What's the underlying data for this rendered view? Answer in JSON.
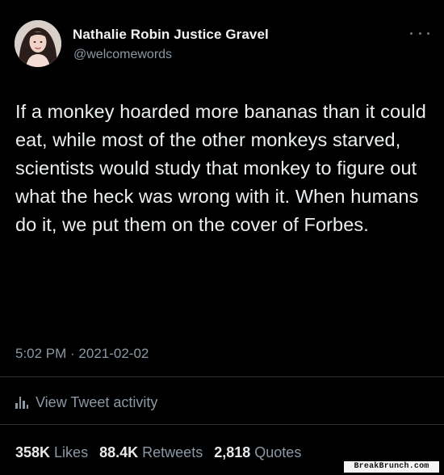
{
  "author": {
    "display_name": "Nathalie Robin Justice Gravel",
    "handle": "@welcomewords",
    "avatar_icon": "profile-photo"
  },
  "tweet": {
    "text": "If a monkey hoarded more bananas than it could eat, while most of the other monkeys starved, scientists would study that monkey to figure out what the heck was wrong with it. When humans do it, we put them on the cover of Forbes.",
    "timestamp": "5:02 PM · 2021-02-02"
  },
  "activity": {
    "label": "View Tweet activity",
    "icon": "bar-chart-icon"
  },
  "stats": {
    "likes_count": "358K",
    "likes_label": "Likes",
    "retweets_count": "88.4K",
    "retweets_label": "Retweets",
    "quotes_count": "2,818",
    "quotes_label": "Quotes"
  },
  "watermark": "BreakBrunch.com",
  "colors": {
    "background": "#000000",
    "text_primary": "#e7e9ea",
    "text_secondary": "#8b98a5",
    "divider": "#2f3336"
  }
}
